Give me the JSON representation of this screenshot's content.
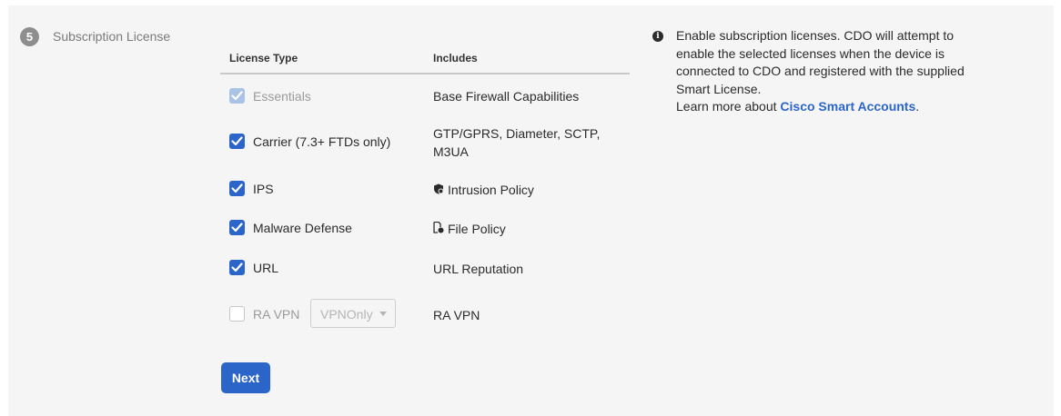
{
  "step": {
    "number": "5",
    "title": "Subscription License"
  },
  "table": {
    "headers": {
      "license_type": "License Type",
      "includes": "Includes"
    },
    "rows": [
      {
        "label": "Essentials",
        "checked": true,
        "disabled": true,
        "includes_line1": "Base Firewall Capabilities",
        "includes_line2": "",
        "icon": ""
      },
      {
        "label": "Carrier (7.3+ FTDs only)",
        "checked": true,
        "disabled": false,
        "includes_line1": "GTP/GPRS, Diameter, SCTP,",
        "includes_line2": "M3UA",
        "icon": ""
      },
      {
        "label": "IPS",
        "checked": true,
        "disabled": false,
        "includes_line1": "Intrusion Policy",
        "includes_line2": "",
        "icon": "shield-icon"
      },
      {
        "label": "Malware Defense",
        "checked": true,
        "disabled": false,
        "includes_line1": "File Policy",
        "includes_line2": "",
        "icon": "file-icon"
      },
      {
        "label": "URL",
        "checked": true,
        "disabled": false,
        "includes_line1": "URL Reputation",
        "includes_line2": "",
        "icon": ""
      },
      {
        "label": "RA VPN",
        "checked": false,
        "disabled": true,
        "includes_line1": "RA VPN",
        "includes_line2": "",
        "icon": ""
      }
    ],
    "ra_vpn_select": {
      "value": "VPNOnly"
    }
  },
  "next_button": {
    "label": "Next"
  },
  "info": {
    "line1": "Enable subscription licenses. CDO will attempt to",
    "line2": "enable the selected licenses when the device is",
    "line3": "connected to CDO and registered with the supplied",
    "line4": "Smart License.",
    "learn_prefix": "Learn more about ",
    "link_text": "Cisco Smart Accounts",
    "learn_suffix": "."
  },
  "colors": {
    "accent": "#2b65c9",
    "panel_bg": "#f5f5f5",
    "step_badge": "#8e8e8e"
  }
}
